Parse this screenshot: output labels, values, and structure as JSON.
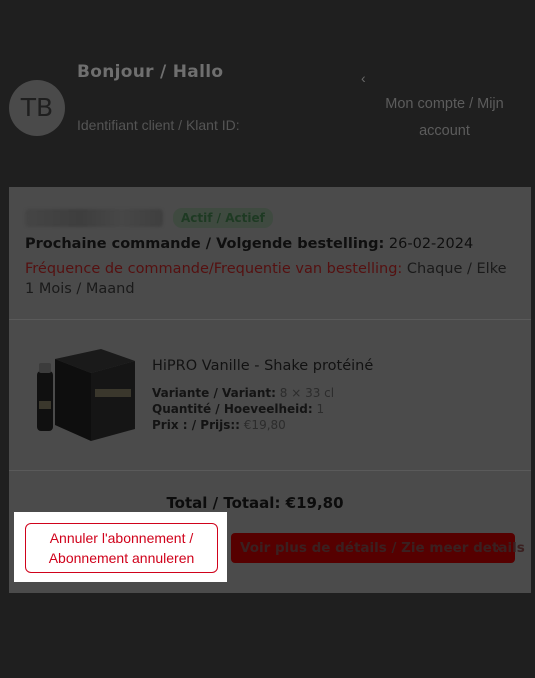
{
  "header": {
    "avatar_initials": "TB",
    "greeting": "Bonjour / Hallo",
    "client_id_label": "Identifiant client / Klant ID:",
    "back_chevron": "‹",
    "account_link": "Mon compte / Mijn account"
  },
  "subscription": {
    "status": "Actif / Actief",
    "next_order_label": "Prochaine commande / Volgende bestelling:",
    "next_order_date": "26-02-2024",
    "frequency_label": "Fréquence de commande/Frequentie van bestelling:",
    "frequency_value": "Chaque / Elke 1 Mois / Maand"
  },
  "product": {
    "title": "HiPRO Vanille - Shake protéiné",
    "variant_label": "Variante / Variant:",
    "variant_value": "8 × 33 cl",
    "quantity_label": "Quantité / Hoeveelheid:",
    "quantity_value": "1",
    "price_label": "Prix : / Prijs::",
    "price_value": "€19,80"
  },
  "total_text": "Total / Totaal: €19,80",
  "actions": {
    "cancel_label": "Annuler l'abonnement / Abonnement annuleren",
    "details_label": "Voir plus de détails / Zie meer details",
    "details_chevron": "›"
  },
  "colors": {
    "page_background": "#1f1f1f",
    "card_background": "#4b4b4b",
    "accent_red": "#d0021b",
    "highlight": "#ffffff"
  },
  "icons": {
    "back": "chevron-left-icon",
    "details": "chevron-right-icon"
  }
}
